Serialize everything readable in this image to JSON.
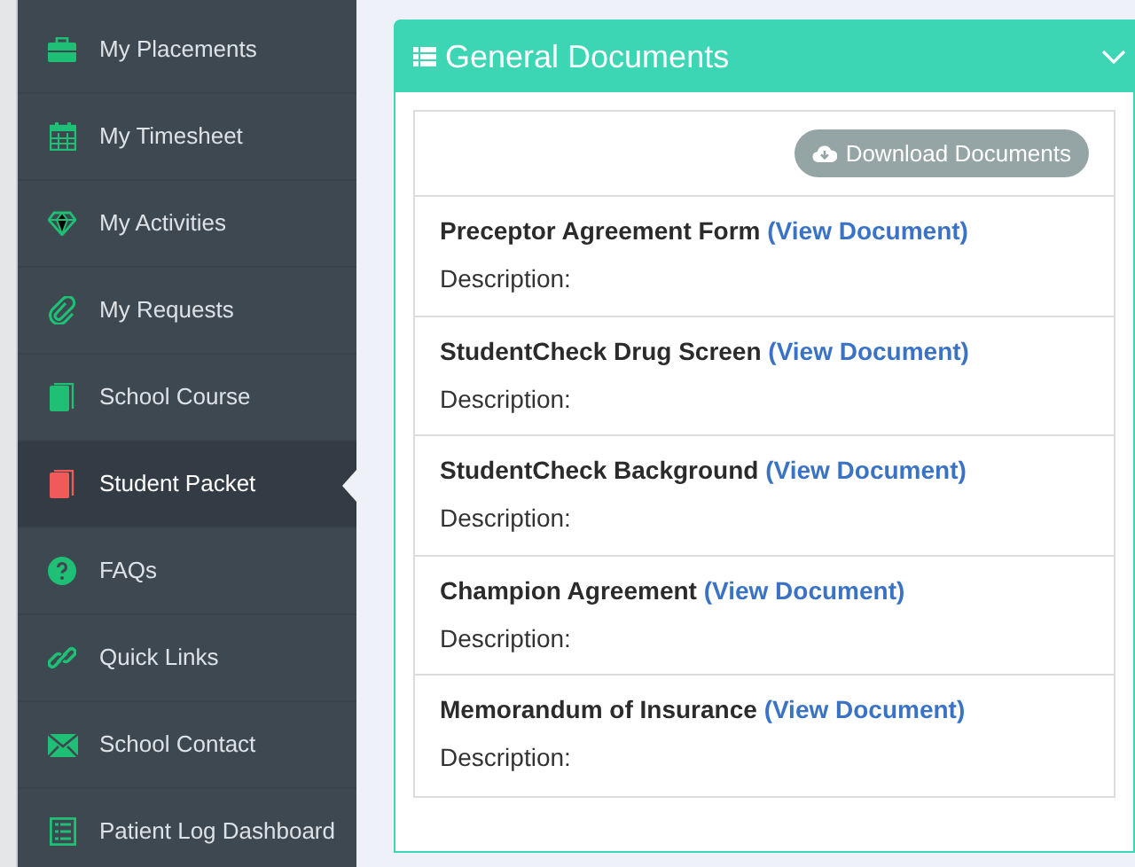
{
  "sidebar": {
    "items": [
      {
        "label": "My Placements",
        "selected": false
      },
      {
        "label": "My Timesheet",
        "selected": false
      },
      {
        "label": "My Activities",
        "selected": false
      },
      {
        "label": "My Requests",
        "selected": false
      },
      {
        "label": "School Course",
        "selected": false
      },
      {
        "label": "Student Packet",
        "selected": true
      },
      {
        "label": "FAQs",
        "selected": false
      },
      {
        "label": "Quick Links",
        "selected": false
      },
      {
        "label": "School Contact",
        "selected": false
      },
      {
        "label": "Patient Log Dashboard",
        "selected": false
      }
    ]
  },
  "panel": {
    "title": "General Documents",
    "download_button": "Download Documents",
    "documents": [
      {
        "name": "Preceptor Agreement Form",
        "link": "(View Document)",
        "description": "Description:"
      },
      {
        "name": "StudentCheck Drug Screen",
        "link": "(View Document)",
        "description": "Description:"
      },
      {
        "name": "StudentCheck Background",
        "link": "(View Document)",
        "description": "Description:"
      },
      {
        "name": "Champion Agreement",
        "link": "(View Document)",
        "description": "Description:"
      },
      {
        "name": "Memorandum of Insurance",
        "link": "(View Document)",
        "description": "Description:"
      }
    ]
  }
}
